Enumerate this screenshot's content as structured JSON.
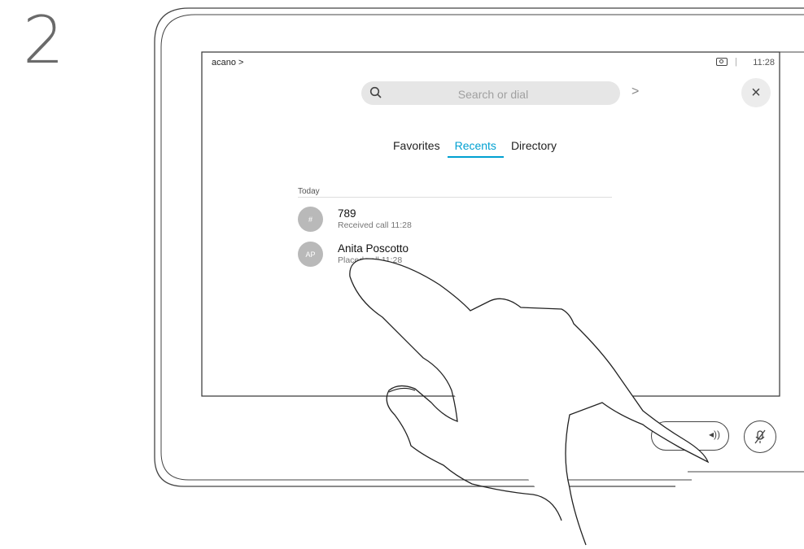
{
  "step": {
    "number": "2"
  },
  "screen": {
    "brand": "acano >",
    "clock": "11:28",
    "separator": "|",
    "search": {
      "placeholder": "Search or dial"
    },
    "dial_arrow": ">",
    "close": "×",
    "tabs": [
      {
        "label": "Favorites",
        "active": false
      },
      {
        "label": "Recents",
        "active": true
      },
      {
        "label": "Directory",
        "active": false
      }
    ],
    "section_label": "Today",
    "recents": [
      {
        "initials": "#",
        "name": "789",
        "detail": "Received call 11:28"
      },
      {
        "initials": "AP",
        "name": "Anita Poscotto",
        "detail": "Placed call 11:28"
      }
    ]
  },
  "controls": {
    "volume_icon": "volume-icon",
    "mute_icon": "mic-mute-icon"
  },
  "colors": {
    "accent": "#00a0d1",
    "avatar": "#b9b9b9",
    "search_bg": "#e6e6e6"
  }
}
